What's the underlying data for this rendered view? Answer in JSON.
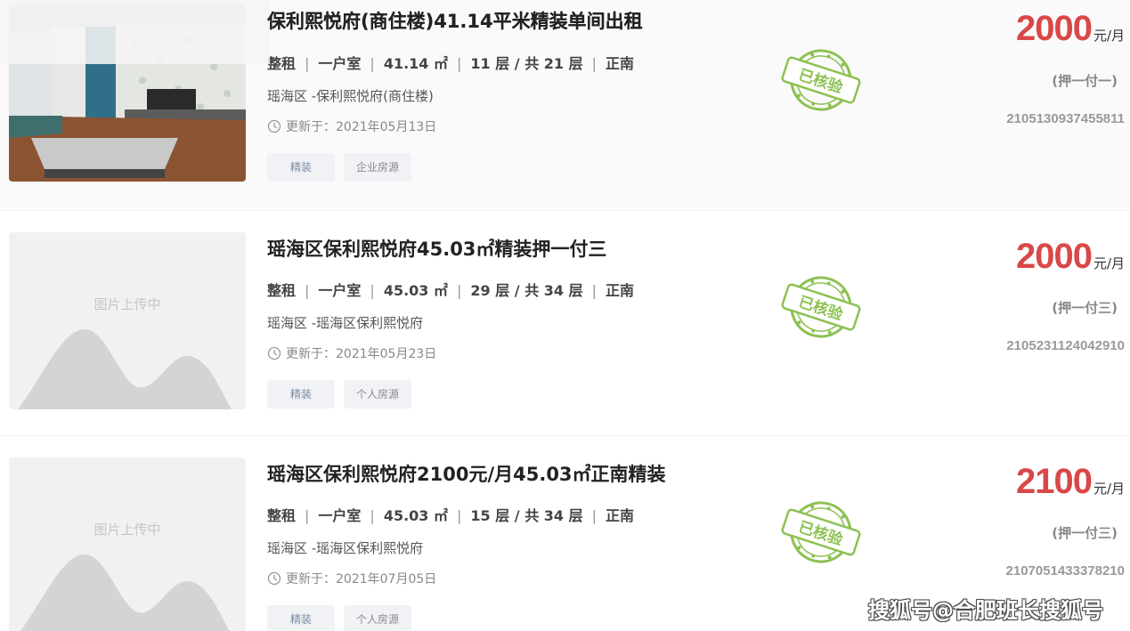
{
  "listings": [
    {
      "title": "保利熙悦府(商住楼)41.14平米精装单间出租",
      "type": "整租",
      "rooms": "一户室",
      "area": "41.14 ㎡",
      "floor": "11 层 / 共 21 层",
      "orientation": "正南",
      "address": "瑶海区 -保利熙悦府(商住楼)",
      "updated_label": "更新于：",
      "updated_date": "2021年05月13日",
      "tags": [
        "精装",
        "企业房源"
      ],
      "stamp": "已核验",
      "price": "2000",
      "price_unit": "元/月",
      "deposit": "(押一付一)",
      "code": "2105130937455811",
      "has_photo": true
    },
    {
      "title": "瑶海区保利熙悦府45.03㎡精装押一付三",
      "type": "整租",
      "rooms": "一户室",
      "area": "45.03 ㎡",
      "floor": "29 层 / 共 34 层",
      "orientation": "正南",
      "address": "瑶海区 -瑶海区保利熙悦府",
      "updated_label": "更新于：",
      "updated_date": "2021年05月23日",
      "tags": [
        "精装",
        "个人房源"
      ],
      "stamp": "已核验",
      "price": "2000",
      "price_unit": "元/月",
      "deposit": "(押一付三)",
      "code": "2105231124042910",
      "placeholder": "图片上传中",
      "has_photo": false
    },
    {
      "title": "瑶海区保利熙悦府2100元/月45.03㎡正南精装",
      "type": "整租",
      "rooms": "一户室",
      "area": "45.03 ㎡",
      "floor": "15 层 / 共 34 层",
      "orientation": "正南",
      "address": "瑶海区 -瑶海区保利熙悦府",
      "updated_label": "更新于：",
      "updated_date": "2021年07月05日",
      "tags": [
        "精装",
        "个人房源"
      ],
      "stamp": "已核验",
      "price": "2100",
      "price_unit": "元/月",
      "deposit": "(押一付三)",
      "code": "2107051433378210",
      "placeholder": "图片上传中",
      "has_photo": false
    }
  ],
  "watermark": "搜狐号@合肥班长搜狐号",
  "colors": {
    "price": "#d94848",
    "stamp": "#8cc152"
  }
}
